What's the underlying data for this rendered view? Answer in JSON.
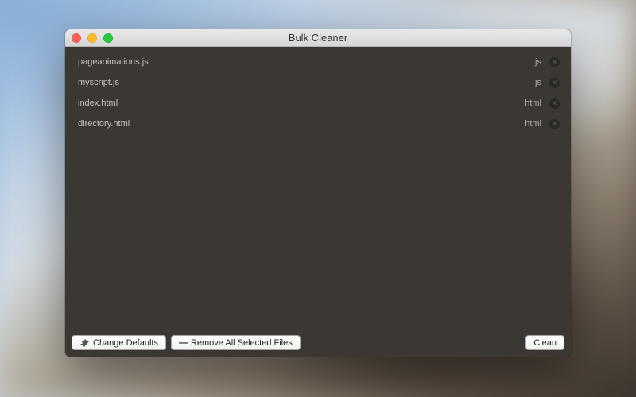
{
  "window": {
    "title": "Bulk Cleaner"
  },
  "files": [
    {
      "name": "pageanimations.js",
      "ext": "js"
    },
    {
      "name": "myscript.js",
      "ext": "js"
    },
    {
      "name": "index.html",
      "ext": "html"
    },
    {
      "name": "directory.html",
      "ext": "html"
    }
  ],
  "footer": {
    "change_defaults": "Change Defaults",
    "remove_all": "Remove All Selected Files",
    "clean": "Clean"
  }
}
